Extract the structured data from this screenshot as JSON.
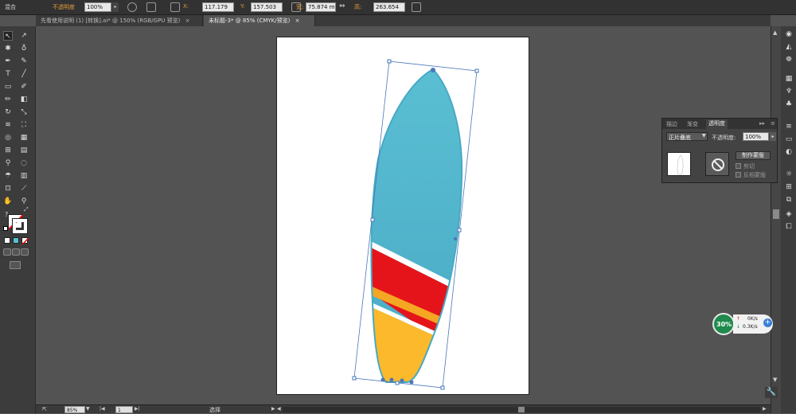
{
  "toolbar": {
    "mode_label": "混合",
    "opacity_label": "不透明度",
    "opacity_value": "100%",
    "x_label": "X:",
    "x_value": "117.179",
    "y_label": "Y:",
    "y_value": "157.503",
    "w_label": "宽:",
    "w_value": "75.874 m",
    "h_label": "高:",
    "h_value": "263.654"
  },
  "tabs": [
    {
      "label": "先看使用说明 (1) [转换].ai* @ 150% (RGB/GPU 预览)",
      "close": "×"
    },
    {
      "label": "未标题-3* @ 85% (CMYK/预览)",
      "close": "×"
    }
  ],
  "left_tools": {
    "help_label": "?"
  },
  "panel": {
    "tabs": [
      "描边",
      "渐变",
      "透明度"
    ],
    "menu": "▸▸",
    "blend_mode": "正片叠底",
    "opacity_label": "不透明度:",
    "opacity_value": "100%",
    "make_mask_button": "制作蒙版",
    "clip_label": "剪切",
    "invert_mask_label": "反相蒙版"
  },
  "status": {
    "zoom": "85%",
    "page": "1",
    "mode_text": "选择"
  },
  "net_widget": {
    "percent": "30%",
    "up": "0K/s",
    "down": "0.3K/s"
  },
  "colors": {
    "board_top": "#5bbfd3",
    "board_top_dark": "#47a9c4",
    "stripe_red": "#e5141a",
    "stripe_orange": "#f5a623",
    "board_bottom": "#fbb92b",
    "selection": "#4a78b8"
  }
}
